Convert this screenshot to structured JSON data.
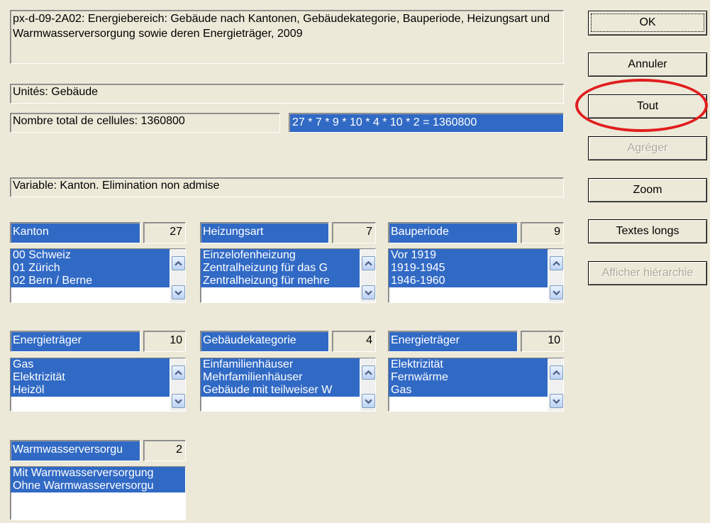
{
  "header": {
    "title": "px-d-09-2A02: Energiebereich: Gebäude nach Kantonen, Gebäudekategorie, Bauperiode, Heizungsart und Warmwasserversorgung sowie deren Energieträger, 2009",
    "units": "Unités: Gebäude",
    "total_cells": "Nombre total de cellules:  1360800",
    "formula": "27 * 7 * 9 * 10 * 4 * 10 * 2  =  1360800",
    "variable_info": "Variable: Kanton. Elimination non admise"
  },
  "buttons": {
    "ok": "OK",
    "cancel": "Annuler",
    "all": "Tout",
    "aggregate": "Agréger",
    "zoom": "Zoom",
    "long_texts": "Textes longs",
    "show_hierarchy": "Afficher hiérarchie"
  },
  "variables": [
    {
      "name": "Kanton",
      "count": "27",
      "items": [
        "00 Schweiz",
        "01 Zürich",
        "02 Bern / Berne"
      ]
    },
    {
      "name": "Heizungsart",
      "count": "7",
      "items": [
        "Einzelofenheizung",
        "Zentralheizung für das G",
        "Zentralheizung für mehre"
      ]
    },
    {
      "name": "Bauperiode",
      "count": "9",
      "items": [
        "Vor 1919",
        "1919-1945",
        "1946-1960"
      ]
    },
    {
      "name": "Energieträger",
      "count": "10",
      "items": [
        "Gas",
        "Elektrizität",
        "Heizöl"
      ]
    },
    {
      "name": "Gebäudekategorie",
      "count": "4",
      "items": [
        "Einfamilienhäuser",
        "Mehrfamilienhäuser",
        "Gebäude mit teilweiser W"
      ]
    },
    {
      "name": "Energieträger",
      "count": "10",
      "items": [
        "Elektrizität",
        "Fernwärme",
        "Gas"
      ]
    },
    {
      "name": "Warmwasserversorgu",
      "count": "2",
      "items": [
        "Mit Warmwasserversorgung",
        "Ohne Warmwasserversorgu"
      ]
    }
  ],
  "colors": {
    "selection_blue": "#316ac5",
    "dialog_background": "#ece9d8",
    "highlight_ring": "#e11e1e"
  }
}
